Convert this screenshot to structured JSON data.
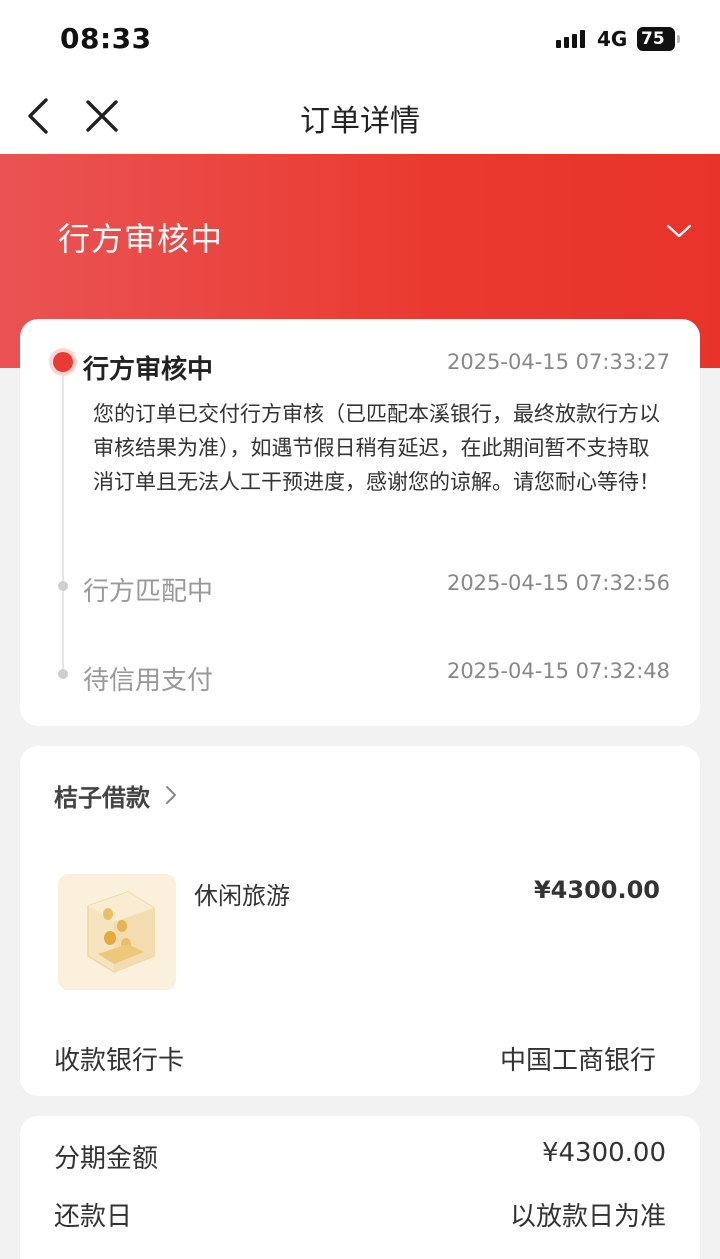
{
  "status_bar": {
    "time": "08:33",
    "network": "4G",
    "battery": "75"
  },
  "nav": {
    "title": "订单详情"
  },
  "header": {
    "status": "行方审核中",
    "accent_color": "#e8332a"
  },
  "timeline": {
    "items": [
      {
        "title": "行方审核中",
        "time": "2025-04-15 07:33:27",
        "description": "您的订单已交付行方审核（已匹配本溪银行，最终放款行方以审核结果为准），如遇节假日稍有延迟，在此期间暂不支持取消订单且无法人工干预进度，感谢您的谅解。请您耐心等待！"
      },
      {
        "title": "行方匹配中",
        "time": "2025-04-15 07:32:56"
      },
      {
        "title": "待信用支付",
        "time": "2025-04-15 07:32:48"
      }
    ]
  },
  "product": {
    "merchant": "桔子借款",
    "name": "休闲旅游",
    "price": "¥4300.00",
    "bank_card_label": "收款银行卡",
    "bank_card_value": "中国工商银行"
  },
  "loan": {
    "rows": [
      {
        "label": "分期金额",
        "value": "¥4300.00"
      },
      {
        "label": "还款日",
        "value": "以放款日为准"
      }
    ]
  }
}
